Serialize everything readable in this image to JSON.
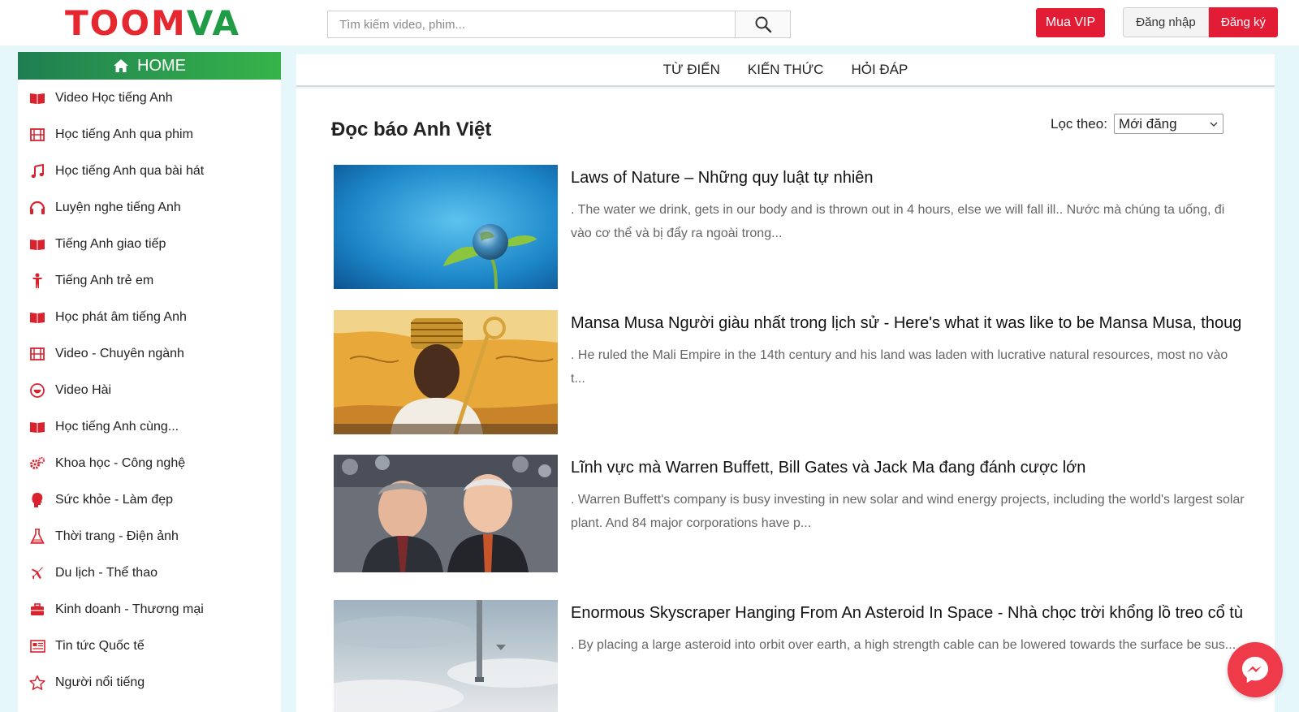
{
  "header": {
    "logo_part1": "TOOM",
    "logo_part2": "VA",
    "search_placeholder": "Tìm kiếm video, phim...",
    "vip_label": "Mua VIP",
    "login_label": "Đăng nhập",
    "register_label": "Đăng ký"
  },
  "sidebar": {
    "home_label": "HOME",
    "items": [
      {
        "label": "Video Học tiếng Anh",
        "icon": "book-icon"
      },
      {
        "label": "Học tiếng Anh qua phim",
        "icon": "film-icon"
      },
      {
        "label": "Học tiếng Anh qua bài hát",
        "icon": "music-icon"
      },
      {
        "label": "Luyện nghe tiếng Anh",
        "icon": "headphones-icon"
      },
      {
        "label": "Tiếng Anh giao tiếp",
        "icon": "book-icon"
      },
      {
        "label": "Tiếng Anh trẻ em",
        "icon": "child-icon"
      },
      {
        "label": "Học phát âm tiếng Anh",
        "icon": "book-icon"
      },
      {
        "label": "Video - Chuyên ngành",
        "icon": "film-icon"
      },
      {
        "label": "Video Hài",
        "icon": "smile-icon"
      },
      {
        "label": "Học tiếng Anh cùng...",
        "icon": "book-icon"
      },
      {
        "label": "Khoa học - Công nghệ",
        "icon": "gears-icon"
      },
      {
        "label": "Sức khỏe - Làm đẹp",
        "icon": "head-icon"
      },
      {
        "label": "Thời trang - Điện ảnh",
        "icon": "flask-icon"
      },
      {
        "label": "Du lịch - Thể thao",
        "icon": "plane-icon"
      },
      {
        "label": "Kinh doanh - Thương mại",
        "icon": "briefcase-icon"
      },
      {
        "label": "Tin tức Quốc tế",
        "icon": "newspaper-icon"
      },
      {
        "label": "Người nổi tiếng",
        "icon": "star-icon"
      }
    ]
  },
  "nav": {
    "items": [
      "TỪ ĐIỂN",
      "KIẾN THỨC",
      "HỎI ĐÁP"
    ]
  },
  "main": {
    "title": "Đọc báo Anh Việt",
    "filter_label": "Lọc theo:",
    "filter_value": "Mới đăng",
    "articles": [
      {
        "title": "Laws of Nature – Những quy luật tự nhiên",
        "desc": ". The water we drink, gets in our body and is thrown out in 4 hours, else we will fall ill.. Nước mà chúng ta uống, đi vào cơ thể và bị đẩy ra ngoài trong..."
      },
      {
        "title": "Mansa Musa Người giàu nhất trong lịch sử - Here's what it was like to be Mansa Musa, thoug",
        "desc": ". He ruled the Mali Empire in the 14th century and his land was laden with lucrative natural resources, most no vào t..."
      },
      {
        "title": "Lĩnh vực mà Warren Buffett, Bill Gates và Jack Ma đang đánh cược lớn",
        "desc": ". Warren Buffett's company is busy investing in new solar and wind energy projects, including the world's largest solar plant. And 84 major corporations have p..."
      },
      {
        "title": "Enormous Skyscraper Hanging From An Asteroid In Space - Nhà chọc trời khổng lồ treo cổ tù",
        "desc": ". By placing a large asteroid into orbit over earth, a high strength cable can be lowered towards the surface be sus..."
      }
    ]
  },
  "colors": {
    "brand_red": "#e21c34",
    "brand_green": "#1f9c45",
    "icon_red": "#d8232f"
  }
}
